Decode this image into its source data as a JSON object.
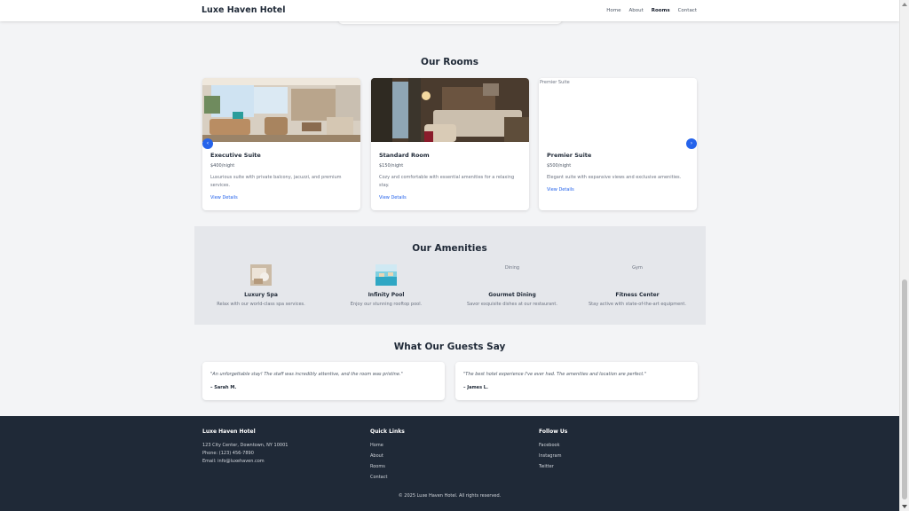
{
  "header": {
    "brand": "Luxe Haven Hotel",
    "nav": [
      "Home",
      "About",
      "Rooms",
      "Contact"
    ],
    "active_nav": "Rooms"
  },
  "rooms": {
    "title": "Our Rooms",
    "items": [
      {
        "name": "Executive Suite",
        "price": "$400/night",
        "description": "Luxurious suite with private balcony, jacuzzi, and premium services.",
        "link": "View Details"
      },
      {
        "name": "Standard Room",
        "price": "$150/night",
        "description": "Cozy and comfortable with essential amenities for a relaxing stay.",
        "link": "View Details"
      },
      {
        "name": "Premier Suite",
        "image_alt": "Premier Suite",
        "price": "$500/night",
        "description": "Elegant suite with expansive views and exclusive amenities.",
        "link": "View Details"
      }
    ]
  },
  "amenities": {
    "title": "Our Amenities",
    "items": [
      {
        "name": "Luxury Spa",
        "description": "Relax with our world-class spa services."
      },
      {
        "name": "Infinity Pool",
        "description": "Enjoy our stunning rooftop pool."
      },
      {
        "name": "Gourmet Dining",
        "image_alt": "Dining",
        "description": "Savor exquisite dishes at our restaurant."
      },
      {
        "name": "Fitness Center",
        "image_alt": "Gym",
        "description": "Stay active with state-of-the-art equipment."
      }
    ]
  },
  "testimonials": {
    "title": "What Our Guests Say",
    "items": [
      {
        "quote": "\"An unforgettable stay! The staff was incredibly attentive, and the room was pristine.\"",
        "author": "– Sarah M."
      },
      {
        "quote": "\"The best hotel experience I've ever had. The amenities and location are perfect.\"",
        "author": "– James L."
      }
    ]
  },
  "footer": {
    "about": {
      "title": "Luxe Haven Hotel",
      "address": "123 City Center, Downtown, NY 10001",
      "phone": "Phone: (123) 456-7890",
      "email": "Email: info@luxehaven.com"
    },
    "links": {
      "title": "Quick Links",
      "items": [
        "Home",
        "About",
        "Rooms",
        "Contact"
      ]
    },
    "social": {
      "title": "Follow Us",
      "items": [
        "Facebook",
        "Instagram",
        "Twitter"
      ]
    },
    "copyright": "© 2025 Luxe Haven Hotel. All rights reserved."
  },
  "carousel": {
    "prev_icon": "chevron-left-icon",
    "next_icon": "chevron-right-icon"
  },
  "colors": {
    "accent": "#2563eb",
    "footer_bg": "#1f2937",
    "amenities_bg": "#e5e7eb",
    "page_bg": "#f3f4f6"
  }
}
